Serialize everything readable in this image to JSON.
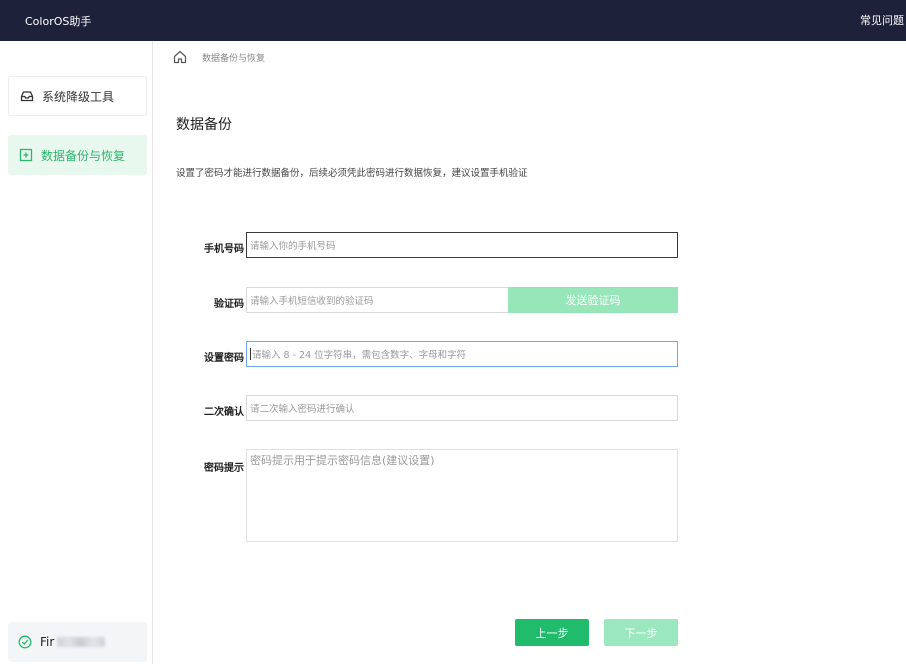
{
  "header": {
    "app_title": "ColorOS助手",
    "faq_label": "常见问题"
  },
  "sidebar": {
    "items": [
      {
        "label": "系统降级工具",
        "icon": "inbox-icon"
      },
      {
        "label": "数据备份与恢复",
        "icon": "plus-square-icon",
        "active": true
      }
    ],
    "device": {
      "name_visible": "Fir",
      "icon": "check-circle-icon"
    }
  },
  "breadcrumb": {
    "current": "数据备份与恢复",
    "icon": "home-icon"
  },
  "main": {
    "title": "数据备份",
    "description": "设置了密码才能进行数据备份，后续必须凭此密码进行数据恢复，建议设置手机验证"
  },
  "form": {
    "phone": {
      "label": "手机号码",
      "placeholder": "请输入你的手机号码"
    },
    "code": {
      "label": "验证码",
      "placeholder": "请输入手机短信收到的验证码",
      "send_label": "发送验证码"
    },
    "password": {
      "label": "设置密码",
      "placeholder": "请输入 8 - 24 位字符串，需包含数字、字母和字符"
    },
    "confirm": {
      "label": "二次确认",
      "placeholder": "请二次输入密码进行确认"
    },
    "hint": {
      "label": "密码提示",
      "placeholder": "密码提示用于提示密码信息(建议设置)"
    }
  },
  "actions": {
    "prev_label": "上一步",
    "next_label": "下一步"
  },
  "colors": {
    "header_bg": "#1d2139",
    "accent": "#20bc6c",
    "accent_light": "#96e6b9",
    "active_item_bg": "#e9f8ee"
  }
}
